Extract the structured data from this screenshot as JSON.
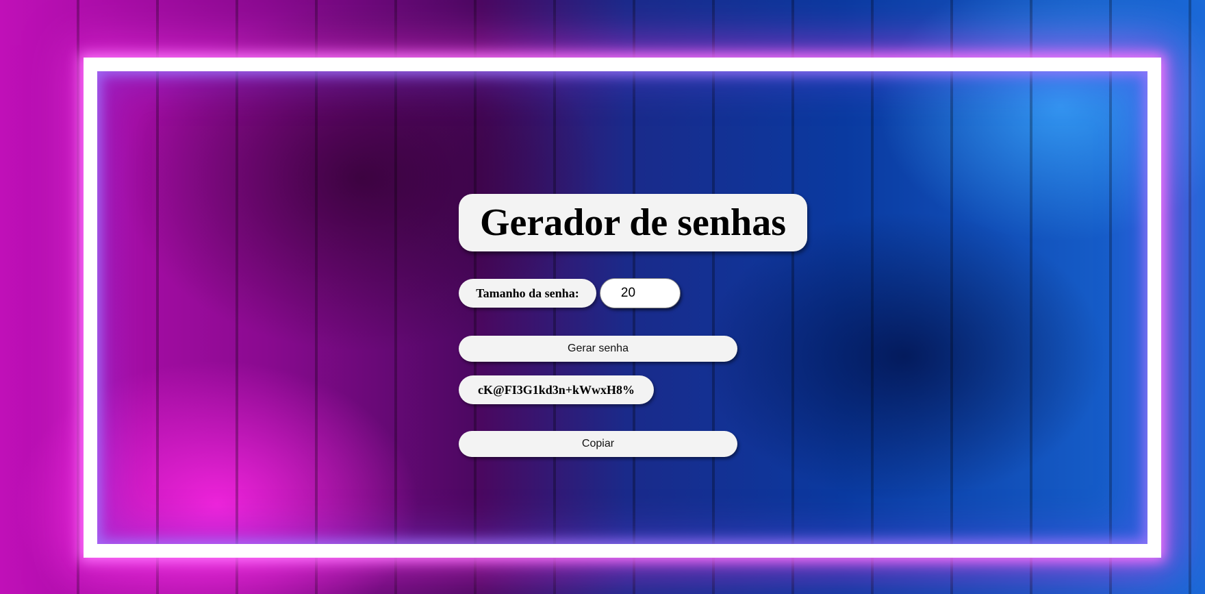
{
  "title": "Gerador de senhas",
  "length_field": {
    "label": "Tamanho da senha:",
    "value": "20"
  },
  "buttons": {
    "generate_label": "Gerar senha",
    "copy_label": "Copiar"
  },
  "generated_password": "cK@FI3G1kd3n+kWwxH8%",
  "colors": {
    "panel_background": "#f3f3f3",
    "neon_frame": "#ffffff",
    "background_left": "#c010b8",
    "background_right": "#1a6ad8"
  }
}
